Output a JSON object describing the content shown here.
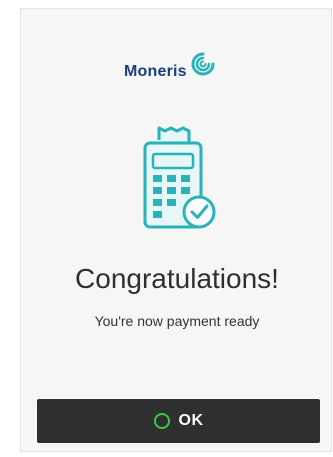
{
  "brand": {
    "name": "Moneris",
    "logo_icon": "moneris-swirl-icon"
  },
  "main": {
    "illustration_icon": "payment-terminal-check-icon",
    "title": "Congratulations!",
    "subtitle": "You're now payment ready"
  },
  "footer": {
    "ok_label": "OK",
    "ok_icon": "ok-circle-icon"
  },
  "colors": {
    "accent": "#29b3b9",
    "button_bg": "#2f2f2f",
    "ok_green": "#3ec93e",
    "brand_blue": "#1b3f7a"
  }
}
